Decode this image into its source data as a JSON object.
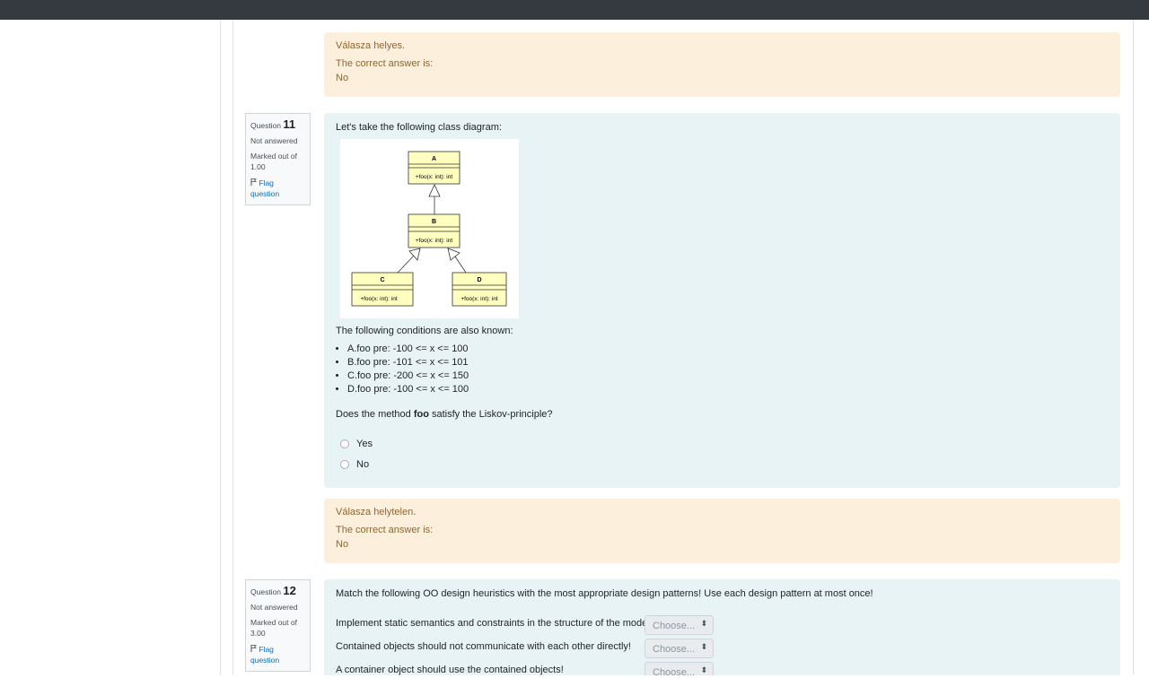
{
  "feedback_top": {
    "status": "Válasza helyes.",
    "correct_label": "The correct answer is:",
    "correct_value": "No"
  },
  "q11": {
    "info": {
      "label": "Question",
      "number": "11",
      "state": "Not answered",
      "mark_line1": "Marked out of",
      "mark_line2": "1.00",
      "flag_line1": "Flag",
      "flag_line2": "question"
    },
    "intro": "Let's take the following class diagram:",
    "diagram": {
      "classes": [
        {
          "name": "A",
          "method": "+foo(x: int): int"
        },
        {
          "name": "B",
          "method": "+foo(x: int): int"
        },
        {
          "name": "C",
          "method": "+foo(x: int): int"
        },
        {
          "name": "D",
          "method": "+foo(x: int): int"
        }
      ]
    },
    "conditions_intro": "The following conditions are also known:",
    "conditions": [
      "A.foo pre: -100 <= x <= 100",
      "B.foo pre: -101 <= x <= 101",
      "C.foo pre: -200 <= x <= 150",
      "D.foo pre: -100 <= x <= 100"
    ],
    "question_pre": "Does the method ",
    "question_bold": "foo",
    "question_post": " satisfy the Liskov-principle?",
    "options": [
      "Yes",
      "No"
    ],
    "feedback": {
      "status": "Válasza helytelen.",
      "correct_label": "The correct answer is:",
      "correct_value": "No"
    }
  },
  "q12": {
    "info": {
      "label": "Question",
      "number": "12",
      "state": "Not answered",
      "mark_line1": "Marked out of",
      "mark_line2": "3.00",
      "flag_line1": "Flag",
      "flag_line2": "question"
    },
    "intro": "Match the following OO design heuristics with the most appropriate design patterns! Use each design pattern at most once!",
    "rows": [
      {
        "text": "Implement static semantics and constraints in the structure of the model!",
        "select": "Choose..."
      },
      {
        "text": "Contained objects should not communicate with each other directly!",
        "select": "Choose..."
      },
      {
        "text": "A container object should use the contained objects!",
        "select": "Choose..."
      }
    ]
  },
  "colors": {
    "topbar": "#343a40",
    "feedback_bg": "#fcefdc",
    "feedback_text": "#8e662e",
    "formulation_bg": "#e7f3f5",
    "link": "#0f6cbf",
    "uml_fill": "#ffffc0"
  }
}
